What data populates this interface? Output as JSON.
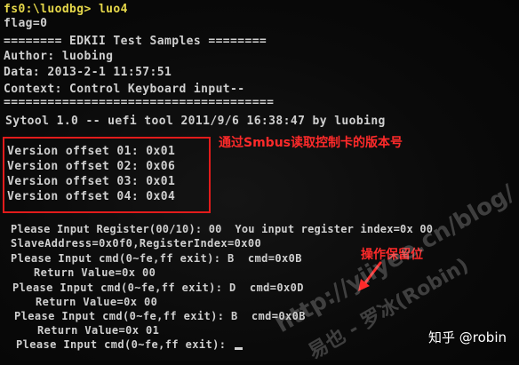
{
  "terminal": {
    "lines": [
      "fs0:\\luodbg> luo4",
      "flag=0",
      "======== EDKII Test Samples ========",
      "Author: luobing",
      "Data: 2013-2-1 11:57:51",
      "Context: Control Keyboard input--",
      "=====================================",
      "Sytool 1.0 -- uefi tool 2011/9/6 16:38:47 by luobing",
      "Version offset 01: 0x01",
      "Version offset 02: 0x06",
      "Version offset 03: 0x01",
      "Version offset 04: 0x04",
      "Please Input Register(00/10): 00  You input register index=0x 00",
      "SlaveAddress=0x0f0,RegisterIndex=0x00",
      "Please Input cmd(0~fe,ff exit): B  cmd=0x0B",
      "Return Value=0x 00",
      "Please Input cmd(0~fe,ff exit): D  cmd=0x0D",
      "Return Value=0x 00",
      "Please Input cmd(0~fe,ff exit): B  cmd=0x0B",
      "Return Value=0x 01",
      "Please Input cmd(0~fe,ff exit): "
    ]
  },
  "annotations": {
    "version_note": "通过Smbus读取控制卡的版本号",
    "operation_note": "操作保留位"
  },
  "watermark": {
    "url": "http://yiiyee.cn/blog/",
    "author": "易也 - 罗冰(Robin)"
  },
  "footer": {
    "credit": "知乎 @robin"
  },
  "colors": {
    "prompt": "#e6d84a",
    "text": "#cfcfcf",
    "annotation": "#ff2a2a"
  }
}
